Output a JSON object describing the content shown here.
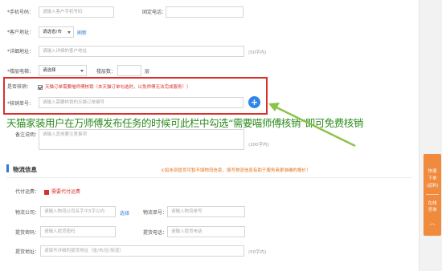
{
  "form": {
    "phone_label": "*手机号码：",
    "phone_placeholder": "请输入客户手机号码",
    "landline_label": "固定电话：",
    "landline_value": "",
    "address_label": "*客户地址：",
    "region_select": "请选省/市",
    "refresh_link": "刷新",
    "detail_label": "*详细地址：",
    "detail_placeholder": "请输入详细的客户地址",
    "detail_counter": "(50字内)",
    "floor_elevator_label": "*楼层电梯：",
    "elevator_select": "请选择",
    "floor_label": "楼层数：",
    "floor_unit": "层",
    "verify_label": "是否核销：",
    "verify_check_text": "天猫订单需要喵师傅核销（本天猫订单勾选时，以免师傅无法完成服务！）",
    "verify_code_label": "*核销单号：",
    "verify_code_placeholder": "请输入需要核销的天猫订单编号",
    "plus_symbol": "+",
    "remark_label": "备注说明：",
    "remark_placeholder": "请输入其他要注意事项",
    "remark_counter": "(200字内)"
  },
  "annotation": {
    "caption": "天猫家装用户在万师傅发布任务的时候可此栏中勾选“需要喵师傅核销”即可免费核销"
  },
  "logistics": {
    "title": "物流信息",
    "notice": "①如未到提货可暂不填物流信息，填写物流信息有助于服务商更准确的报价！",
    "cod_label": "代付运费：",
    "cod_check_text": "需要代付运费",
    "company_label": "物流公司：",
    "company_placeholder": "请输入物流公司名字中3字以内",
    "select_link": "选择",
    "tracking_label": "物流单号：",
    "tracking_placeholder": "请输入物流单号",
    "pickup_code_label": "提货密码：",
    "pickup_code_placeholder": "请输入提货密码",
    "pickup_phone_label": "提货电话：",
    "pickup_phone_placeholder": "请输入提货电话",
    "pickup_address_label": "提货地址：",
    "pickup_address_placeholder": "请填写详细的提货地址（省/市/区/街道）",
    "pickup_address_counter": "(50字内)"
  },
  "side_float": {
    "line1": "快速",
    "line2": "下单",
    "line3": "(返利)",
    "line4": "在线",
    "line5": "咨询"
  },
  "colors": {
    "accent_blue": "#2f7bd9",
    "highlight_red": "#d9302c",
    "caption_green": "#2e8b1f",
    "side_orange": "#f08a3c"
  }
}
